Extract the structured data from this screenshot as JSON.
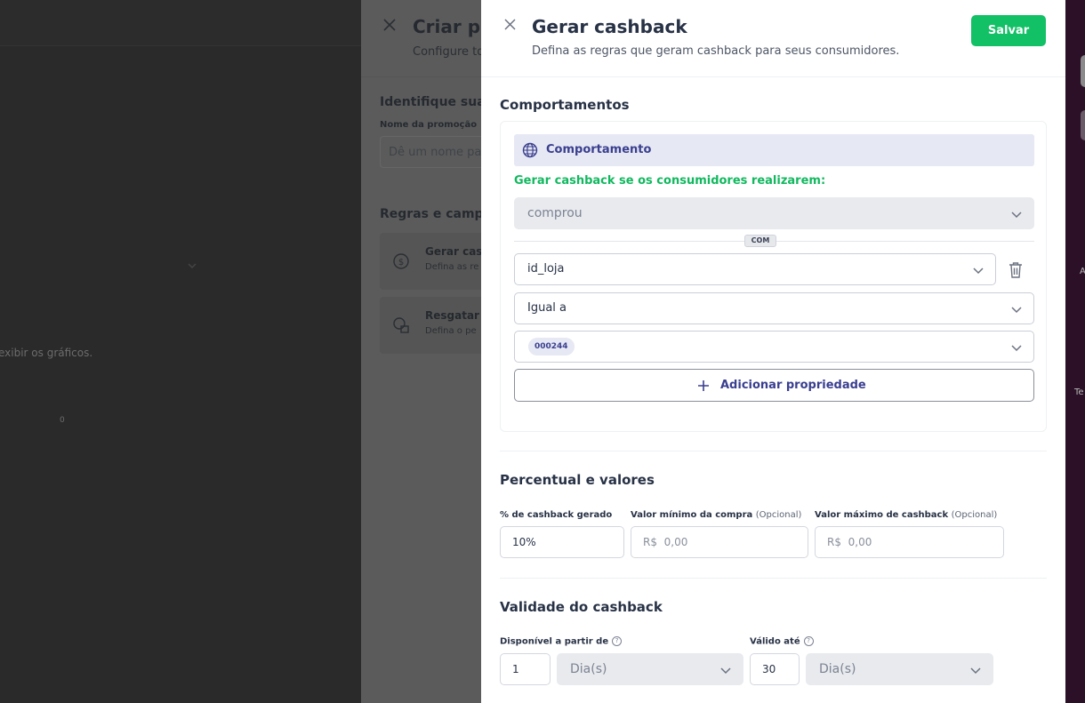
{
  "background": {
    "chart_message": "exibir os gráficos.",
    "zero_label": "0"
  },
  "drawer_criar": {
    "title": "Criar pro",
    "subtitle": "Configure to",
    "section_identify": "Identifique sua p",
    "name_label": "Nome da promoção",
    "name_placeholder": "Dê um nome par",
    "section_rules": "Regras e campa",
    "rule_cards": [
      {
        "title": "Gerar cas",
        "desc": "Defina as re",
        "icon": "dollar-circle-icon"
      },
      {
        "title": "Resgatar c",
        "desc": "Defina o pe",
        "icon": "coins-icon"
      }
    ]
  },
  "right_edge": {
    "t1": "A",
    "t2": "Te"
  },
  "drawer": {
    "title": "Gerar cashback",
    "subtitle": "Defina as regras que geram cashback para seus consumidores.",
    "save_label": "Salvar",
    "behaviors": {
      "section_title": "Comportamentos",
      "card_title": "Comportamento",
      "trigger_label": "Gerar cashback se os consumidores realizarem:",
      "event_value": "comprou",
      "connector": "COM",
      "property": "id_loja",
      "operator": "Igual a",
      "value_tag": "000244",
      "add_property_label": "Adicionar propriedade"
    },
    "values": {
      "section_title": "Percentual e valores",
      "percent_label": "% de cashback gerado",
      "percent_value": "10%",
      "min_label": "Valor mínimo da compra",
      "max_label": "Valor máximo de cashback",
      "optional_text": "(Opcional)",
      "currency": "R$",
      "min_placeholder": "0,00",
      "max_placeholder": "0,00"
    },
    "validity": {
      "section_title": "Validade do cashback",
      "from_label": "Disponível a partir de",
      "from_value": "1",
      "from_unit": "Dia(s)",
      "until_label": "Válido até",
      "until_value": "30",
      "until_unit": "Dia(s)",
      "help_icon": "?"
    }
  },
  "colors": {
    "accent_green": "#12c066",
    "accent_indigo": "#3a3f8f"
  }
}
